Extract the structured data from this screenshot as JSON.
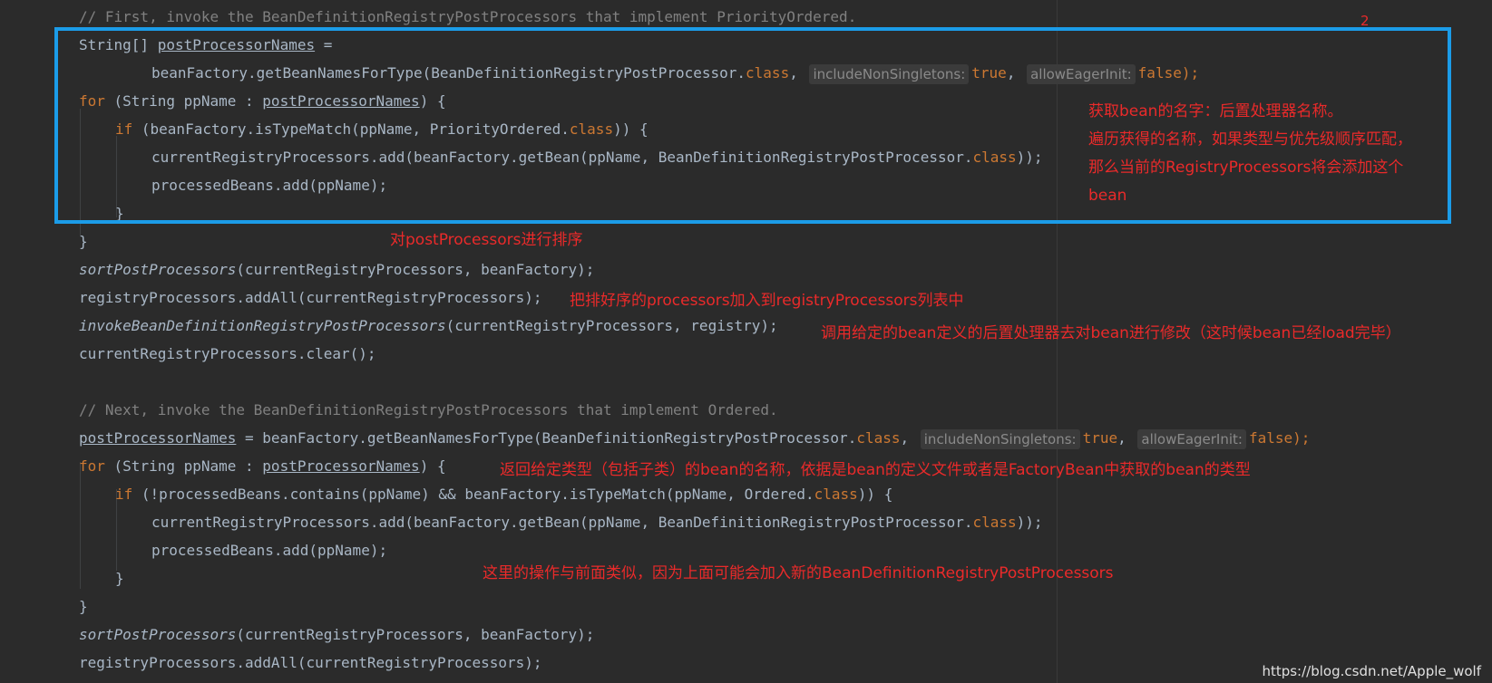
{
  "code": {
    "l1_comment": "// First, invoke the BeanDefinitionRegistryPostProcessors that implement PriorityOrdered.",
    "l2_a": "String[] ",
    "l2_var": "postProcessorNames",
    "l2_b": " =",
    "l3_a": "beanFactory.getBeanNamesForType(BeanDefinitionRegistryPostProcessor.",
    "l3_kw1": "class",
    "l3_b": ", ",
    "l3_hint1": "includeNonSingletons:",
    "l3_kw2": "true",
    "l3_c": ", ",
    "l3_hint2": "allowEagerInit:",
    "l3_kw3": "false",
    "l3_d": ");",
    "l4_kw": "for",
    "l4_a": " (String ppName : ",
    "l4_var": "postProcessorNames",
    "l4_b": ") {",
    "l5_kw": "if",
    "l5_a": " (beanFactory.isTypeMatch(ppName, PriorityOrdered.",
    "l5_kw2": "class",
    "l5_b": ")) {",
    "l6_a": "currentRegistryProcessors.add(beanFactory.getBean(ppName, BeanDefinitionRegistryPostProcessor.",
    "l6_kw": "class",
    "l6_b": "));",
    "l7_a": "processedBeans.add(ppName);",
    "l8_a": "}",
    "l9_a": "}",
    "l10_fn": "sortPostProcessors",
    "l10_a": "(currentRegistryProcessors, beanFactory);",
    "l11_a": "registryProcessors.addAll(currentRegistryProcessors);",
    "l12_fn": "invokeBeanDefinitionRegistryPostProcessors",
    "l12_a": "(currentRegistryProcessors, registry);",
    "l13_a": "currentRegistryProcessors.clear();",
    "l15_comment": "// Next, invoke the BeanDefinitionRegistryPostProcessors that implement Ordered.",
    "l16_var": "postProcessorNames",
    "l16_a": " = beanFactory.getBeanNamesForType(BeanDefinitionRegistryPostProcessor.",
    "l16_kw1": "class",
    "l16_b": ", ",
    "l16_hint1": "includeNonSingletons:",
    "l16_kw2": "true",
    "l16_c": ", ",
    "l16_hint2": "allowEagerInit:",
    "l16_kw3": "false",
    "l16_d": ");",
    "l17_kw": "for",
    "l17_a": " (String ppName : ",
    "l17_var": "postProcessorNames",
    "l17_b": ") {",
    "l18_kw": "if",
    "l18_a": " (!processedBeans.contains(ppName) && beanFactory.isTypeMatch(ppName, Ordered.",
    "l18_kw2": "class",
    "l18_b": ")) {",
    "l19_a": "currentRegistryProcessors.add(beanFactory.getBean(ppName, BeanDefinitionRegistryPostProcessor.",
    "l19_kw": "class",
    "l19_b": "));",
    "l20_a": "processedBeans.add(ppName);",
    "l21_a": "}",
    "l22_a": "}",
    "l23_fn": "sortPostProcessors",
    "l23_a": "(currentRegistryProcessors, beanFactory);",
    "l24_a": "registryProcessors.addAll(currentRegistryProcessors);"
  },
  "annotations": {
    "box_marker": "2",
    "box_note": "获取bean的名字：后置处理器名称。\n遍历获得的名称，如果类型与优先级顺序匹配，\n那么当前的RegistryProcessors将会添加这个\nbean",
    "sort_note": "对postProcessors进行排序",
    "addall_note": "把排好序的processors加入到registryProcessors列表中",
    "invoke_note": "调用给定的bean定义的后置处理器去对bean进行修改（这时候bean已经load完毕）",
    "for_note": "返回给定类型（包括子类）的bean的名称，依据是bean的定义文件或者是FactoryBean中获取的bean的类型",
    "similar_note": "这里的操作与前面类似，因为上面可能会加入新的BeanDefinitionRegistryPostProcessors"
  },
  "watermark": "https://blog.csdn.net/Apple_wolf",
  "colors": {
    "background": "#2b2b2b",
    "code_text": "#a9b7c6",
    "keyword": "#cc7832",
    "comment": "#808080",
    "annotation": "#ea2a2a",
    "highlight_box": "#1b9ce8"
  }
}
